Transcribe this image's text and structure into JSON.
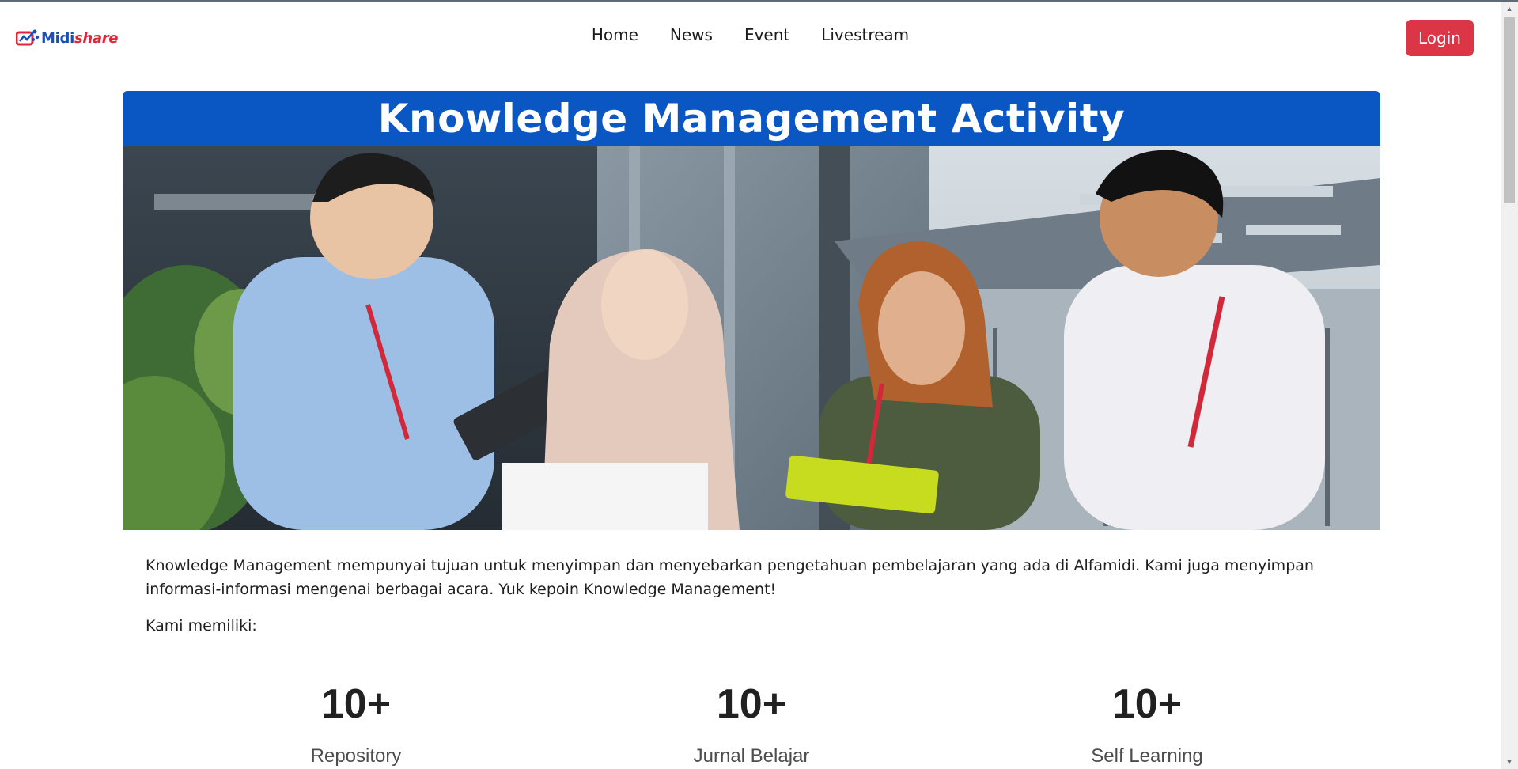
{
  "brand": {
    "name_part1": "Midi",
    "name_part2": "share"
  },
  "nav": {
    "items": [
      {
        "label": "Home"
      },
      {
        "label": "News"
      },
      {
        "label": "Event"
      },
      {
        "label": "Livestream"
      }
    ],
    "login_label": "Login"
  },
  "hero": {
    "title": "Knowledge Management Activity"
  },
  "content": {
    "intro": "Knowledge Management mempunyai tujuan untuk menyimpan dan menyebarkan pengetahuan pembelajaran yang ada di Alfamidi. Kami juga menyimpan informasi-informasi mengenai berbagai acara. Yuk kepoin Knowledge Management!",
    "have_label": "Kami memiliki:"
  },
  "stats": [
    {
      "value": "10+",
      "label": "Repository"
    },
    {
      "value": "10+",
      "label": "Jurnal Belajar"
    },
    {
      "value": "10+",
      "label": "Self Learning"
    }
  ],
  "colors": {
    "brand_blue": "#1a4fb5",
    "brand_red": "#e0263a",
    "hero_bar": "#0a56c2",
    "login_button": "#dc3545"
  }
}
